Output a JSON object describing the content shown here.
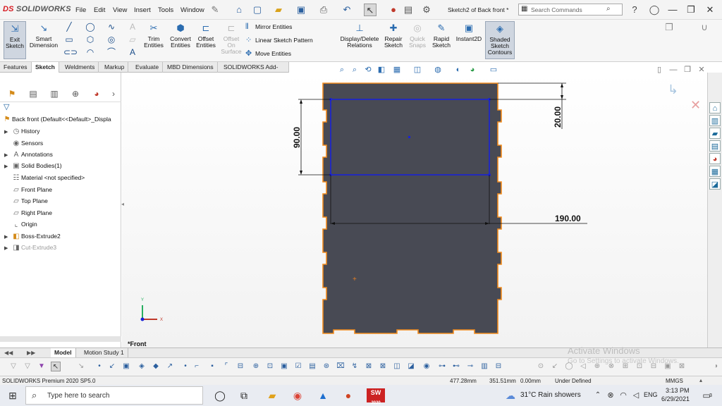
{
  "app": {
    "logo_prefix": "DS",
    "logo_text": "SOLIDWORKS",
    "document_title": "Sketch2 of Back front *"
  },
  "menu": [
    "File",
    "Edit",
    "View",
    "Insert",
    "Tools",
    "Window"
  ],
  "search": {
    "placeholder": "Search Commands"
  },
  "ribbon": {
    "exit_sketch": "Exit Sketch",
    "smart_dimension": "Smart Dimension",
    "trim_entities": "Trim Entities",
    "convert_entities": "Convert Entities",
    "offset_entities": "Offset Entities",
    "offset_on_surface": "Offset On Surface",
    "mirror_entities": "Mirror Entities",
    "linear_sketch_pattern": "Linear Sketch Pattern",
    "move_entities": "Move Entities",
    "display_delete_relations": "Display/Delete Relations",
    "repair_sketch": "Repair Sketch",
    "quick_snaps": "Quick Snaps",
    "rapid_sketch": "Rapid Sketch",
    "instant2d": "Instant2D",
    "shaded_sketch_contours": "Shaded Sketch Contours"
  },
  "tabs": [
    "Features",
    "Sketch",
    "Weldments",
    "Markup",
    "Evaluate",
    "MBD Dimensions",
    "SOLIDWORKS Add-Ins"
  ],
  "tree": {
    "root": "Back front  (Default<<Default>_Displa",
    "items": [
      "History",
      "Sensors",
      "Annotations",
      "Solid Bodies(1)",
      "Material <not specified>",
      "Front Plane",
      "Top Plane",
      "Right Plane",
      "Origin",
      "Boss-Extrude2",
      "Cut-Extrude3"
    ]
  },
  "dimensions": {
    "height": "90.00",
    "offset": "20.00",
    "width": "190.00"
  },
  "view_label": "*Front",
  "bottom_tabs": [
    "Model",
    "Motion Study 1"
  ],
  "status": {
    "product": "SOLIDWORKS Premium 2020 SP5.0",
    "x": "477.28mm",
    "y": "351.51mm",
    "z": "0.00mm",
    "state": "Under Defined",
    "units": "MMGS"
  },
  "watermark": {
    "title": "Activate Windows",
    "subtitle": "Go to Settings to activate Windows."
  },
  "taskbar": {
    "search_placeholder": "Type here to search",
    "weather": "31°C  Rain showers",
    "lang": "ENG",
    "time": "3:13 PM",
    "date": "6/29/2021",
    "notifications": "3",
    "sw_badge": "2020"
  },
  "colors": {
    "part_fill": "#484a54",
    "part_edge": "#f28c1e",
    "sketch_blue": "#1a23d6",
    "dimension": "#111111"
  }
}
